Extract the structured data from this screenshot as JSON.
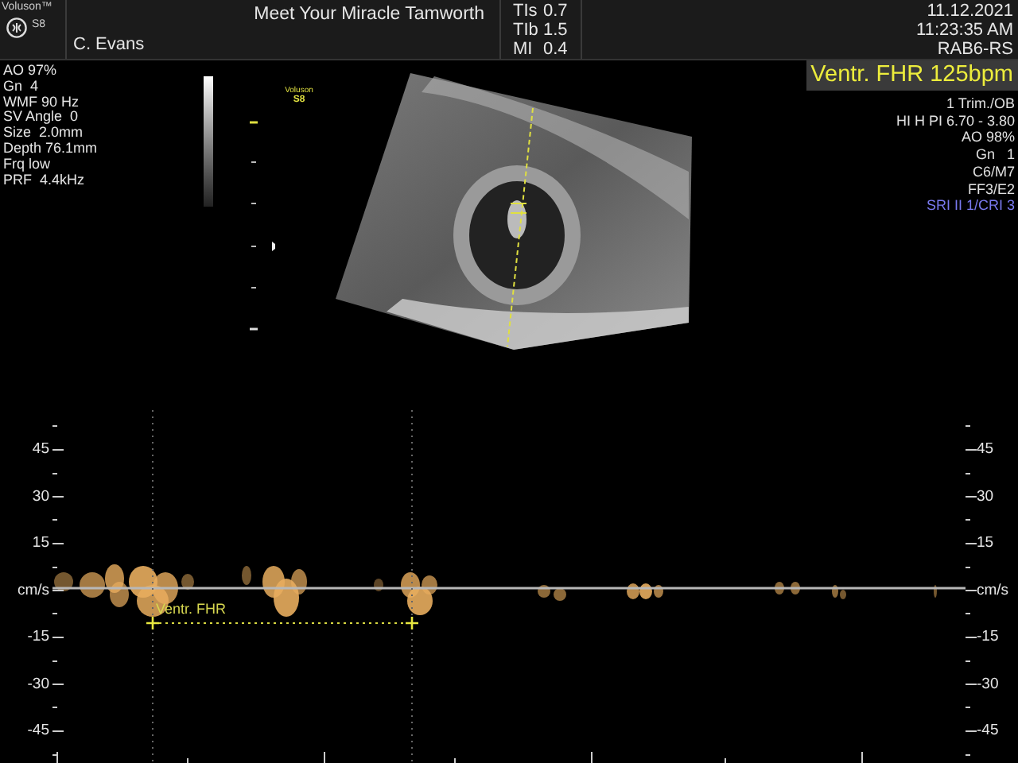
{
  "header": {
    "brand": "Voluson™",
    "model": "S8",
    "patient": "C. Evans",
    "title": "Meet Your Miracle Tamworth",
    "indices": [
      {
        "label": "TIs",
        "value": "0.7"
      },
      {
        "label": "TIb",
        "value": "1.5"
      },
      {
        "label": "MI",
        "value": "0.4"
      }
    ],
    "date": "11.12.2021",
    "time": "11:23:35 AM",
    "probe": "RAB6-RS"
  },
  "left_params": [
    "AO 97%",
    "Gn  4",
    "WMF 90 Hz",
    "SV Angle  0",
    "Size  2.0mm",
    "Depth 76.1mm",
    "Frq low",
    "PRF  4.4kHz"
  ],
  "image_label": {
    "brand": "Voluson",
    "model": "S8"
  },
  "measurement": "Ventr. FHR 125bpm",
  "right_params": [
    {
      "text": "1 Trim./OB",
      "kind": "normal"
    },
    {
      "text": "HI H PI 6.70 - 3.80",
      "kind": "normal"
    },
    {
      "text": "AO 98%",
      "kind": "normal"
    },
    {
      "text": "Gn   1",
      "kind": "normal"
    },
    {
      "text": "C6/M7",
      "kind": "normal"
    },
    {
      "text": "FF3/E2",
      "kind": "normal"
    },
    {
      "text": "SRI II 1/CRI 3",
      "kind": "highlight"
    }
  ],
  "spectrum": {
    "left_axis": [
      "45",
      "30",
      "15",
      "cm/s",
      "-15",
      "-30",
      "-45"
    ],
    "right_axis": [
      "45",
      "30",
      "15",
      "cm/s",
      "-15",
      "-30",
      "-45"
    ],
    "caliper_label": "Ventr. FHR"
  }
}
